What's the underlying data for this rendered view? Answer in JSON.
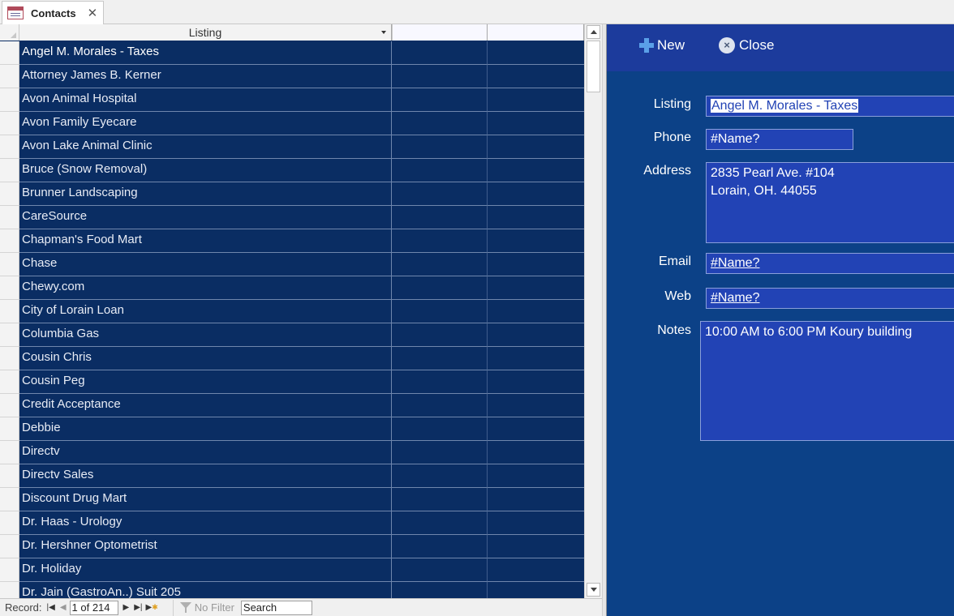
{
  "tab": {
    "title": "Contacts",
    "icon": "form-icon",
    "close_icon": "close-icon",
    "close_glyph": "✕"
  },
  "datasheet": {
    "columns": [
      "Listing",
      "",
      ""
    ],
    "rows": [
      "Angel M. Morales - Taxes",
      "Attorney James B. Kerner",
      "Avon Animal Hospital",
      "Avon Family Eyecare",
      "Avon Lake Animal Clinic",
      "Bruce (Snow Removal)",
      "Brunner Landscaping",
      "CareSource",
      "Chapman's Food Mart",
      "Chase",
      "Chewy.com",
      "City of Lorain Loan",
      "Columbia Gas",
      "Cousin Chris",
      "Cousin Peg",
      "Credit Acceptance",
      "Debbie",
      "Directv",
      "Directv Sales",
      "Discount Drug Mart",
      "Dr. Haas - Urology",
      "Dr. Hershner Optometrist",
      "Dr. Holiday",
      "Dr. Jain (GastroAn..) Suit 205"
    ],
    "colors": {
      "row_bg": "#0a2d63",
      "grid": "#6f86ad"
    }
  },
  "navbar": {
    "record_label": "Record:",
    "position": "1 of 214",
    "filter_label": "No Filter",
    "search_label": "Search",
    "first_glyph": "|◀",
    "prev_glyph": "◀",
    "next_glyph": "▶",
    "last_glyph": "▶|",
    "new_glyph": "▶",
    "new_star": "✱"
  },
  "detail": {
    "toolbar": {
      "new_label": "New",
      "close_label": "Close",
      "close_glyph": "×"
    },
    "labels": {
      "listing": "Listing",
      "phone": "Phone",
      "address": "Address",
      "email": "Email",
      "web": "Web",
      "notes": "Notes"
    },
    "values": {
      "listing": "Angel M. Morales - Taxes",
      "phone": "#Name?",
      "address_line1": "2835 Pearl Ave. #104",
      "address_line2": "Lorain, OH. 44055",
      "email": "#Name?",
      "web": "#Name?",
      "notes": "10:00 AM to 6:00 PM Koury building"
    },
    "colors": {
      "panel_bg": "#0c4187",
      "toolbar_bg": "#1c3b9c",
      "field_bg": "#2243b5"
    }
  }
}
